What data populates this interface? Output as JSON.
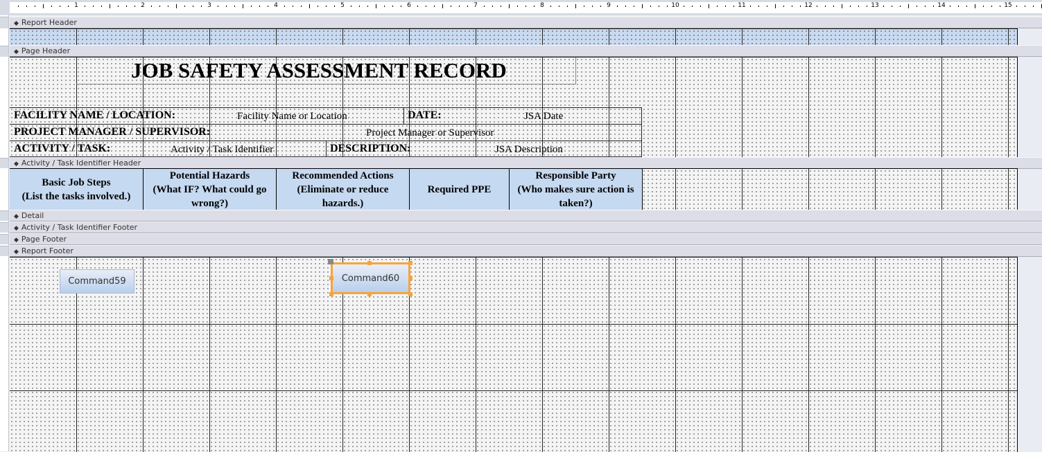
{
  "ruler": {
    "numbers": [
      "1",
      "2",
      "3",
      "4",
      "5",
      "6",
      "7",
      "8",
      "9",
      "10",
      "11",
      "12",
      "13",
      "14",
      "15"
    ]
  },
  "sections": {
    "report_header": "Report Header",
    "page_header": "Page Header",
    "activity_header": "Activity / Task Identifier Header",
    "detail": "Detail",
    "activity_footer": "Activity / Task Identifier Footer",
    "page_footer": "Page Footer",
    "report_footer": "Report Footer"
  },
  "page_header": {
    "title": "JOB SAFETY ASSESSMENT RECORD",
    "facility_label": "FACILITY NAME / LOCATION:",
    "facility_field": "Facility Name or Location",
    "date_label": "DATE:",
    "date_field": "JSA Date",
    "manager_label": "PROJECT MANAGER / SUPERVISOR:",
    "manager_field": "Project Manager or Supervisor",
    "activity_label": "ACTIVITY / TASK:",
    "activity_field": "Activity / Task Identifier",
    "description_label": "DESCRIPTION:",
    "description_field": "JSA Description"
  },
  "columns": [
    {
      "line1": "Basic Job Steps",
      "line2": "(List the tasks involved.)"
    },
    {
      "line1": "Potential Hazards",
      "line2": "(What IF? What could go wrong?)"
    },
    {
      "line1": "Recommended Actions",
      "line2": "(Eliminate or reduce hazards.)"
    },
    {
      "line1": "Required PPE",
      "line2": ""
    },
    {
      "line1": "Responsible Party",
      "line2": "(Who makes sure action is taken?)"
    }
  ],
  "report_footer": {
    "button1": "Command59",
    "button2": "Command60"
  },
  "colors": {
    "header_blue": "#c5d9f1",
    "selection": "#f7a33b"
  }
}
